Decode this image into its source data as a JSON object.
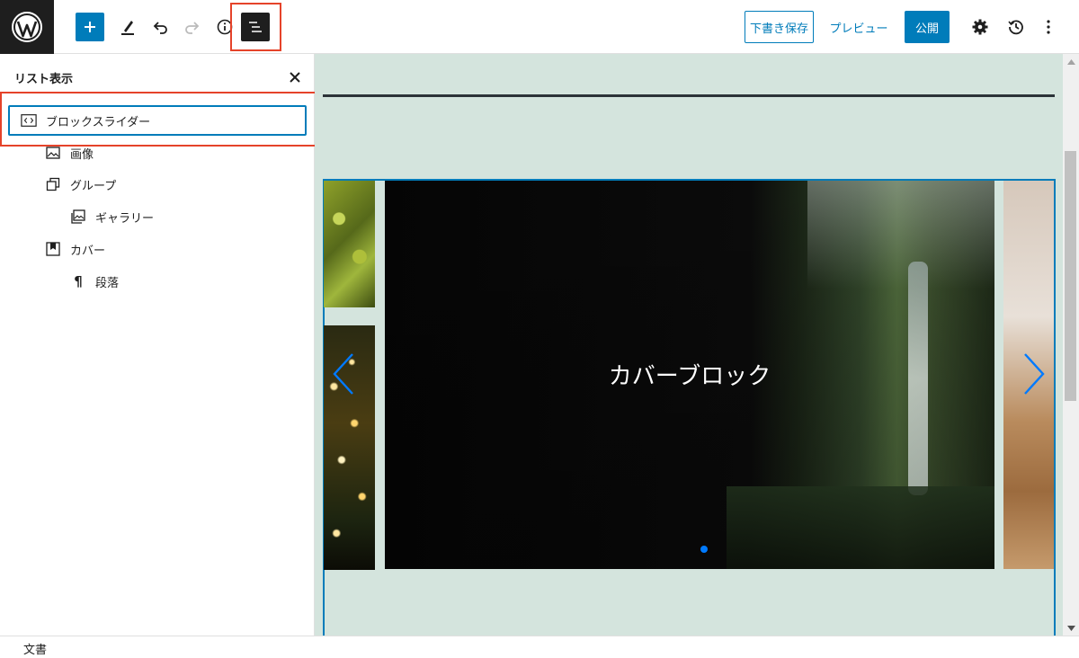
{
  "topbar": {
    "logo_icon": "wordpress-logo",
    "save_draft_label": "下書き保存",
    "preview_label": "プレビュー",
    "publish_label": "公開",
    "accent_color": "#007cba"
  },
  "sidebar": {
    "title": "リスト表示",
    "close_icon": "close-icon",
    "items": [
      {
        "label": "ブロックスライダー",
        "icon": "html-code-icon",
        "selected": true
      },
      {
        "label": "画像",
        "icon": "image-icon"
      },
      {
        "label": "グループ",
        "icon": "group-icon"
      },
      {
        "label": "ギャラリー",
        "icon": "gallery-icon"
      },
      {
        "label": "カバー",
        "icon": "cover-icon"
      },
      {
        "label": "段落",
        "icon": "paragraph-icon"
      }
    ]
  },
  "canvas": {
    "background_color": "#d4e4dd",
    "slider": {
      "cover_text": "カバーブロック",
      "prev_icon": "chevron-left-icon",
      "next_icon": "chevron-right-icon",
      "active_dot_color": "#007aff"
    }
  },
  "footer": {
    "breadcrumb": "文書"
  },
  "highlight_color": "#e5432a"
}
